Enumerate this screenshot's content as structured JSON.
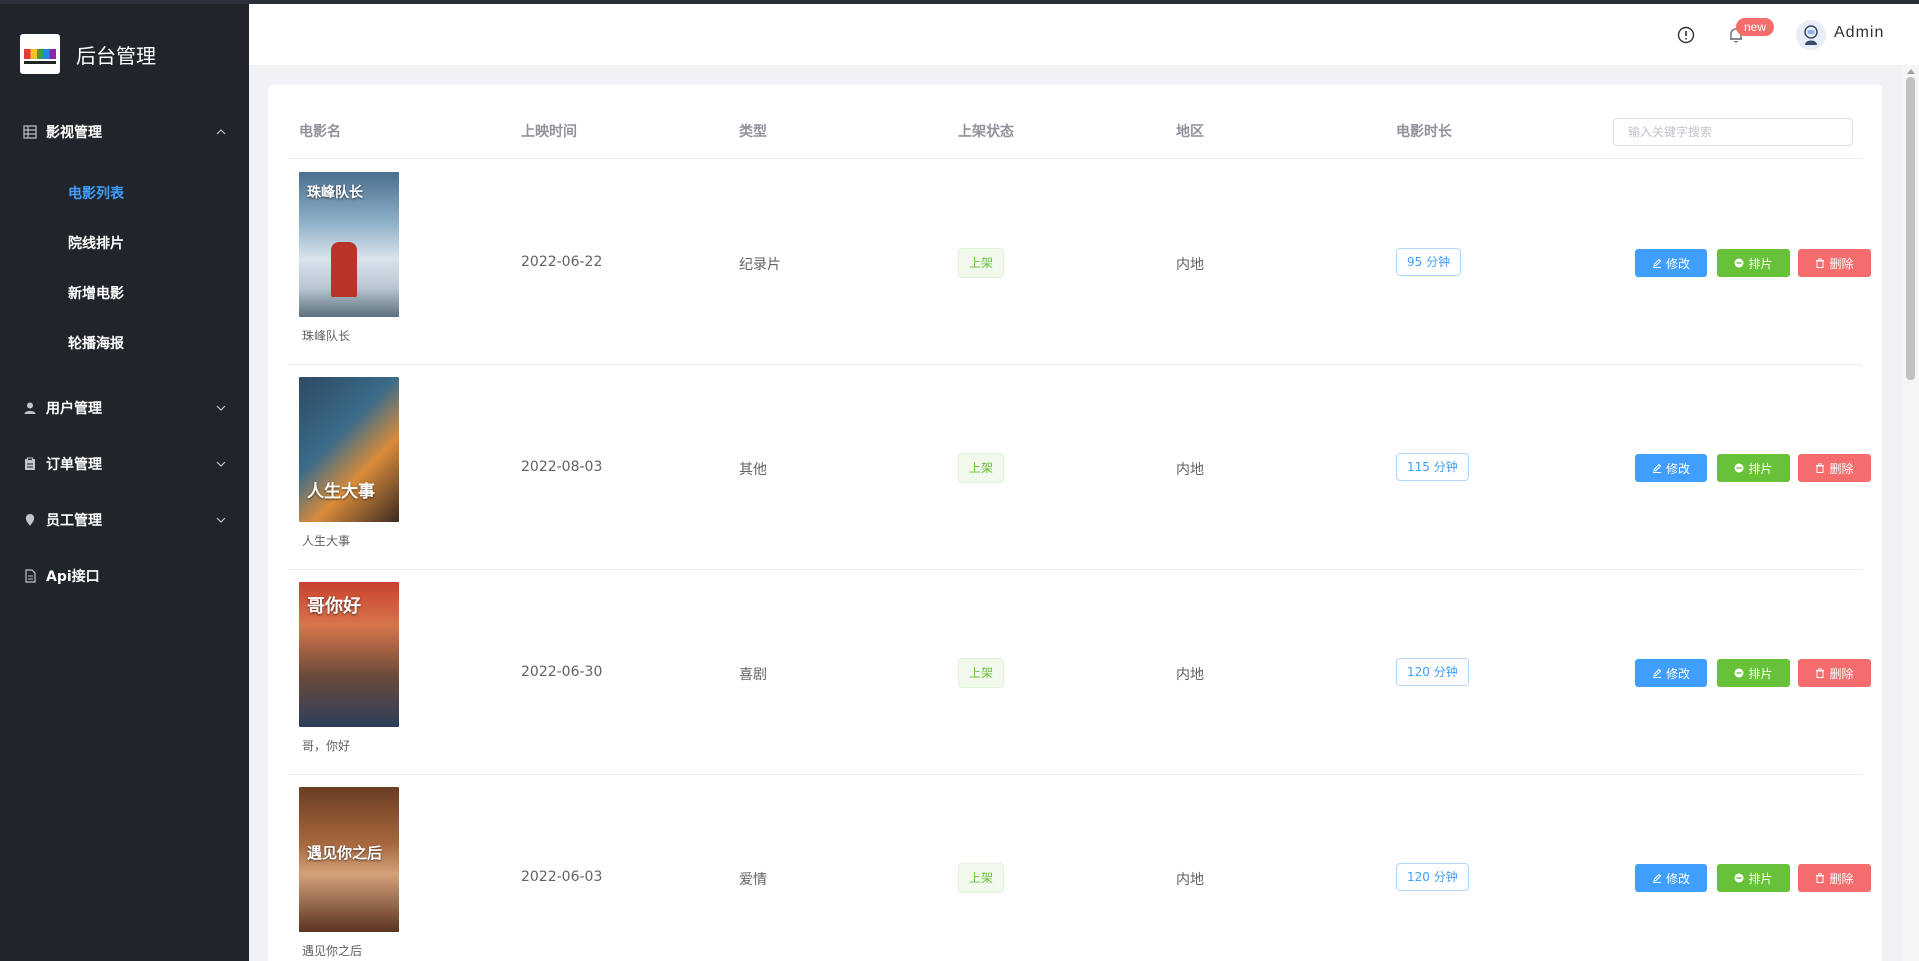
{
  "app": {
    "title": "后台管理"
  },
  "sidebar": {
    "groups": [
      {
        "label": "影视管理",
        "icon": "grid-icon",
        "expanded": true,
        "items": [
          {
            "label": "电影列表",
            "active": true
          },
          {
            "label": "院线排片",
            "active": false
          },
          {
            "label": "新增电影",
            "active": false
          },
          {
            "label": "轮播海报",
            "active": false
          }
        ]
      },
      {
        "label": "用户管理",
        "icon": "user-icon",
        "expanded": false
      },
      {
        "label": "订单管理",
        "icon": "clipboard-icon",
        "expanded": false
      },
      {
        "label": "员工管理",
        "icon": "pin-icon",
        "expanded": false
      },
      {
        "label": "Api接口",
        "icon": "document-icon",
        "expanded": false
      }
    ]
  },
  "header": {
    "badge": "new",
    "username": "Admin"
  },
  "table": {
    "columns": [
      "电影名",
      "上映时间",
      "类型",
      "上架状态",
      "地区",
      "电影时长"
    ],
    "search_placeholder": "输入关键字搜索",
    "actions": {
      "edit": "修改",
      "schedule": "排片",
      "delete": "删除"
    },
    "rows": [
      {
        "name": "珠峰队长",
        "poster_text": "珠峰队长",
        "date": "2022-06-22",
        "genre": "纪录片",
        "status": "上架",
        "region": "内地",
        "duration": "95 分钟"
      },
      {
        "name": "人生大事",
        "poster_text": "人生大事",
        "date": "2022-08-03",
        "genre": "其他",
        "status": "上架",
        "region": "内地",
        "duration": "115 分钟"
      },
      {
        "name": "哥，你好",
        "poster_text": "哥你好",
        "date": "2022-06-30",
        "genre": "喜剧",
        "status": "上架",
        "region": "内地",
        "duration": "120 分钟"
      },
      {
        "name": "遇见你之后",
        "poster_text": "遇见你之后",
        "date": "2022-06-03",
        "genre": "爱情",
        "status": "上架",
        "region": "内地",
        "duration": "120 分钟"
      }
    ]
  },
  "colors": {
    "sidebar_bg": "#20252b",
    "active": "#409eff",
    "success": "#67c23a",
    "danger": "#f56c6c"
  }
}
